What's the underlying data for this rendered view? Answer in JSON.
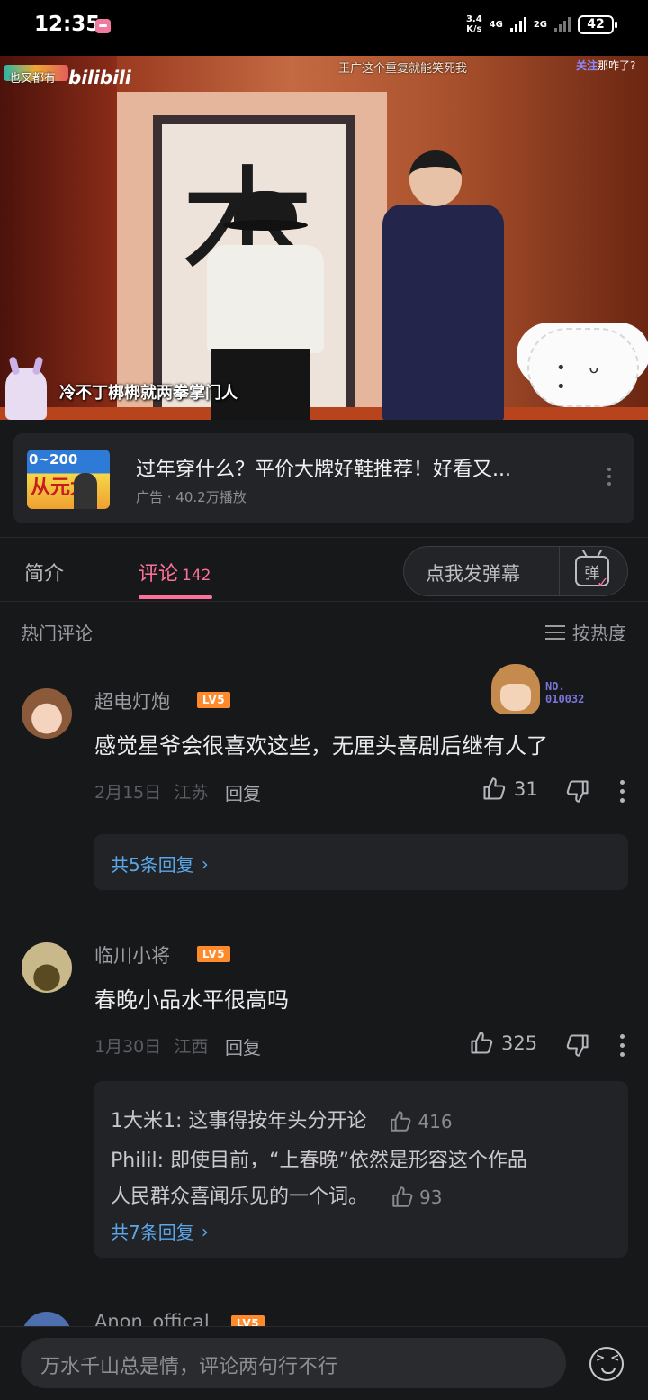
{
  "status_bar": {
    "time": "12:35",
    "speed_value": "3.4",
    "speed_unit": "K/s",
    "network": "4G",
    "network2": "2G",
    "battery": "42"
  },
  "video": {
    "logo_text": "也叉都有",
    "bili_logo": "bilibili",
    "danmaku": "王广这个重复就能笑死我",
    "follow_label": "关注",
    "follow_tail": "那咋了?",
    "subtitle": "冷不丁梆梆就两拳掌门人",
    "calligraphy": "本"
  },
  "ad": {
    "thumb_text": "0~200",
    "thumb_big": "从元大",
    "title": "过年穿什么？平价大牌好鞋推荐！好看又...",
    "meta": "广告 · 40.2万播放"
  },
  "tabs": {
    "intro": "简介",
    "comments": "评论",
    "comments_count": "142",
    "danmaku_placeholder": "点我发弹幕",
    "danmaku_icon": "弹",
    "danmaku_check": "✓"
  },
  "comments_header": {
    "title": "热门评论",
    "sort": "按热度"
  },
  "comments": [
    {
      "username": "超电灯炮",
      "level": "LV5",
      "text": "感觉星爷会很喜欢这些，无厘头喜剧后继有人了",
      "date": "2月15日",
      "location": "江苏",
      "reply": "回复",
      "likes": "31",
      "badge_no": "NO.",
      "badge_num": "010032",
      "more_replies": "共5条回复"
    },
    {
      "username": "临川小将",
      "level": "LV5",
      "text": "春晚小品水平很高吗",
      "date": "1月30日",
      "location": "江西",
      "reply": "回复",
      "likes": "325",
      "replies": [
        {
          "text": "1大米1: 这事得按年头分开论",
          "likes": "416"
        },
        {
          "text": "Philil: 即使目前，“上春晚”依然是形容这个作品",
          "text2": "人民群众喜闻乐见的一个词。",
          "likes": "93"
        }
      ],
      "more_replies": "共7条回复"
    },
    {
      "username": "Anon_offical",
      "level": "LV5"
    }
  ],
  "bottom": {
    "input_placeholder": "万水千山总是情，评论两句行不行"
  },
  "colors": {
    "accent_pink": "#fb7299",
    "link_blue": "#5aa6e8",
    "level_orange": "#ff8a2b"
  }
}
